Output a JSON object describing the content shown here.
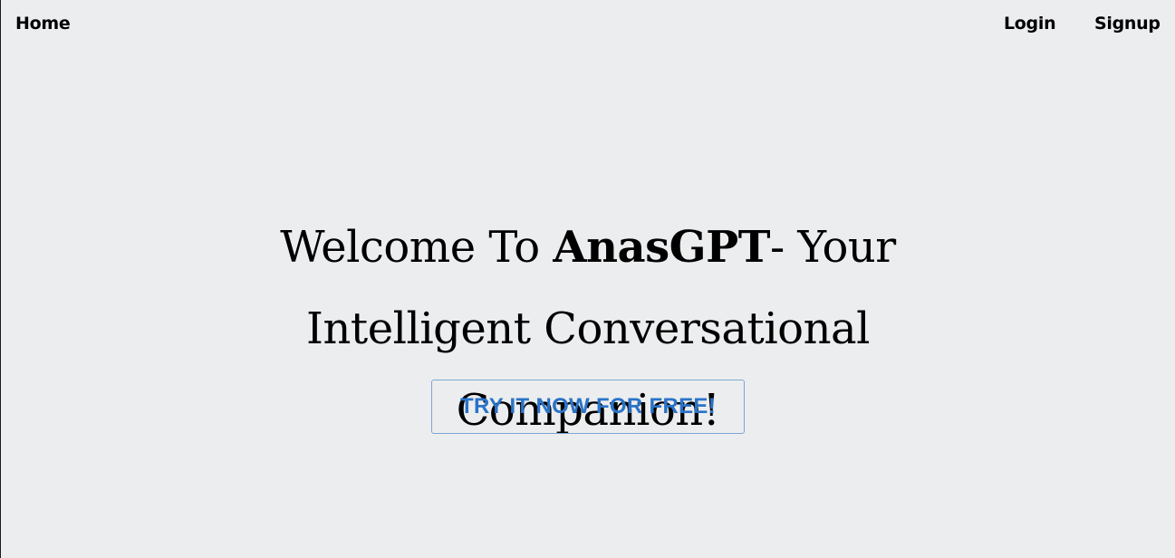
{
  "nav": {
    "home_label": "Home",
    "login_label": "Login",
    "signup_label": "Signup"
  },
  "hero": {
    "title_prefix": "Welcome To ",
    "brand": "AnasGPT",
    "title_suffix": "- Your Intelligent Conversational Companion!",
    "cta_label": "TRY IT NOW FOR FREE!"
  },
  "colors": {
    "background": "#ecedef",
    "accent": "#2a73c8",
    "button_border": "#7ea6d6"
  }
}
